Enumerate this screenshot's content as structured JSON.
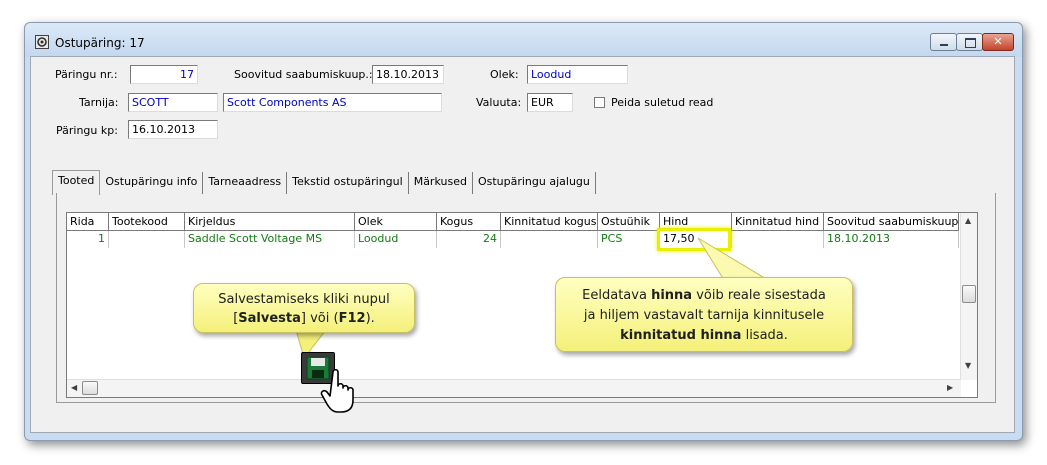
{
  "window": {
    "title": "Ostupäring: 17"
  },
  "form": {
    "request_no_label": "Päringu nr.:",
    "request_no": "17",
    "expected_arrival_label": "Soovitud saabumiskuup.:",
    "expected_arrival": "18.10.2013",
    "status_label": "Olek:",
    "status": "Loodud",
    "supplier_label": "Tarnija:",
    "supplier_code": "SCOTT",
    "supplier_name": "Scott Components AS",
    "currency_label": "Valuuta:",
    "currency": "EUR",
    "hide_closed_label": "Peida suletud read",
    "request_date_label": "Päringu kp:",
    "request_date": "16.10.2013"
  },
  "tabs": [
    "Tooted",
    "Ostupäringu info",
    "Tarneaadress",
    "Tekstid ostupäringul",
    "Märkused",
    "Ostupäringu ajalugu"
  ],
  "grid": {
    "columns": [
      "Rida",
      "Tootekood",
      "Kirjeldus",
      "Olek",
      "Kogus",
      "Kinnitatud kogus",
      "Ostuühik",
      "Hind",
      "Kinnitatud hind",
      "Soovitud saabumiskuup."
    ],
    "rows": [
      [
        "1",
        "",
        "Saddle Scott Voltage MS",
        "Loodud",
        "24",
        "",
        "PCS",
        "17,50",
        "",
        "18.10.2013"
      ]
    ]
  },
  "callouts": {
    "save": {
      "line1": "Salvestamiseks kliki nupul",
      "open1": "[",
      "bold1": "Salvesta",
      "mid1": "] või (",
      "bold2": "F12",
      "close1": ")."
    },
    "price": {
      "line1_pre": "Eeldatava ",
      "line1_bold": "hinna",
      "line1_post": " võib reale sisestada",
      "line2": "ja hiljem vastavalt tarnija kinnitusele",
      "line3_bold": "kinnitatud hinna",
      "line3_post": " lisada."
    }
  },
  "colors": {
    "accent_blue": "#0000c8",
    "row_green": "#107c10",
    "callout_bg": "#f8f49a",
    "highlight": "#e8f000"
  }
}
